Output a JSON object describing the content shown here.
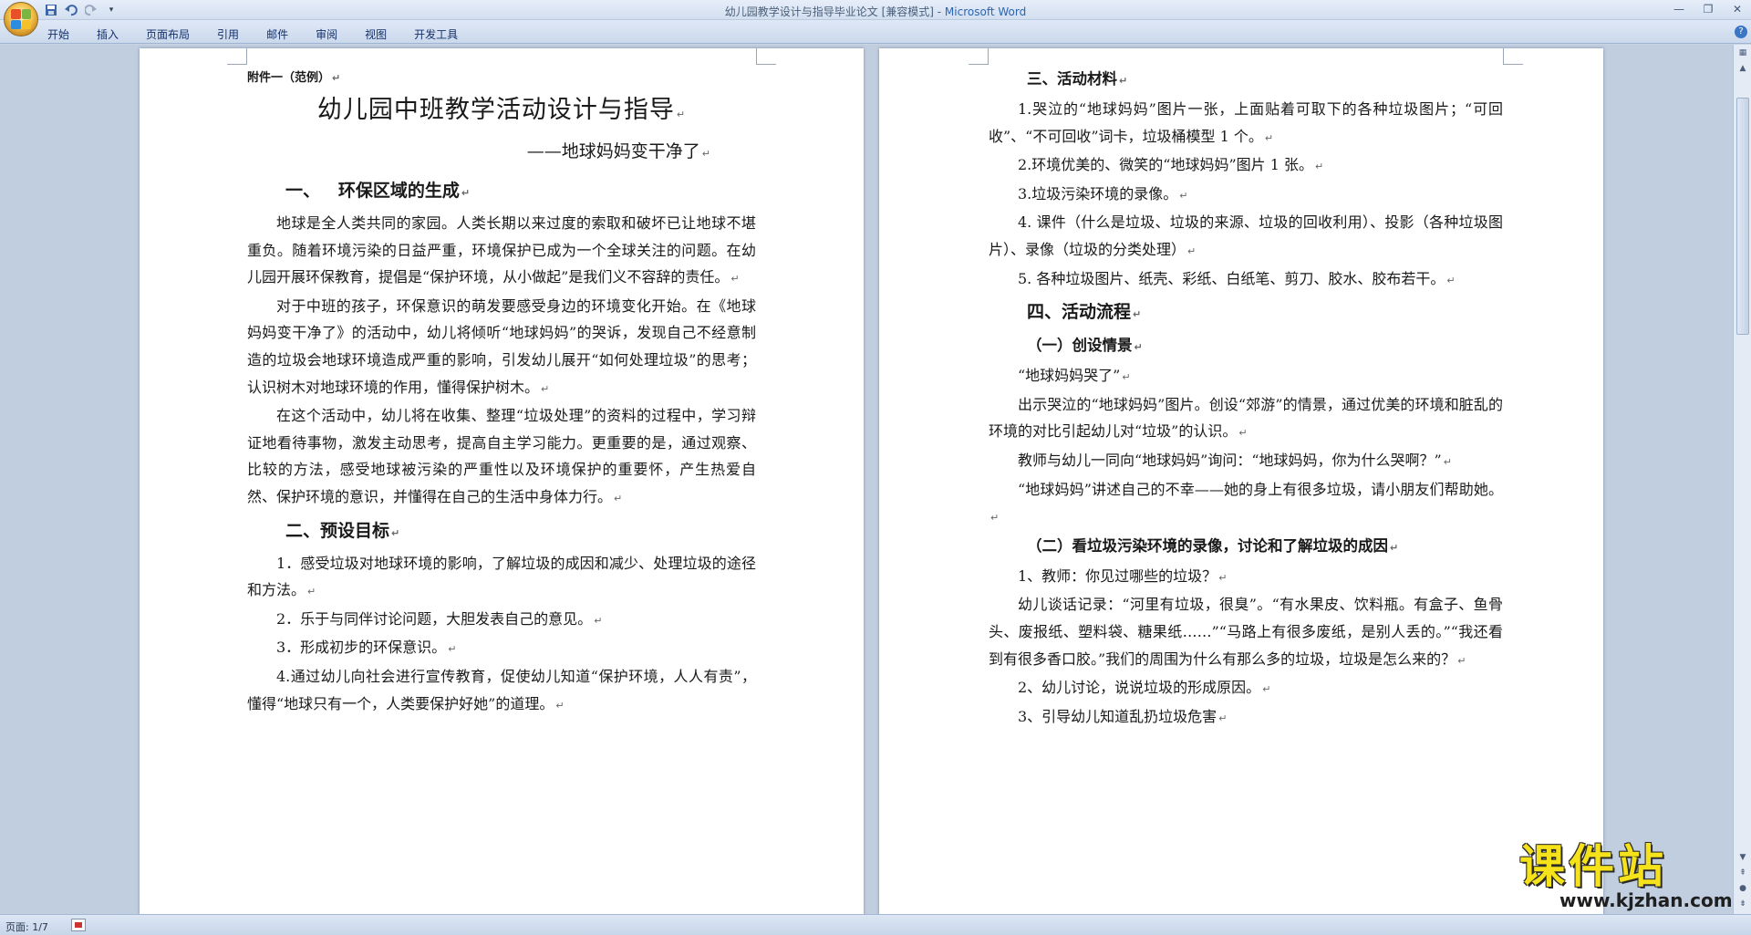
{
  "window": {
    "title": "幼儿园教学设计与指导毕业论文 [兼容模式] - ",
    "app_name": "Microsoft Word"
  },
  "quick_access": {
    "icons": [
      "save-icon",
      "undo-icon",
      "redo-icon",
      "customize-icon"
    ]
  },
  "ribbon": {
    "tabs": [
      "开始",
      "插入",
      "页面布局",
      "引用",
      "邮件",
      "审阅",
      "视图",
      "开发工具"
    ]
  },
  "status_bar": {
    "page_info": "页面: 1/7"
  },
  "watermark": {
    "main": "课件站",
    "url": "www.kjzhan.com"
  },
  "colors": {
    "title_accent": "#2a64b4",
    "watermark_yellow": "#f6e21a"
  },
  "page_left": {
    "annex": "附件一（范例）",
    "title": "幼儿园中班教学活动设计与指导",
    "subtitle": "——地球妈妈变干净了",
    "section1_heading": "一、   环保区域的生成",
    "paragraphs": [
      "地球是全人类共同的家园。人类长期以来过度的索取和破坏已让地球不堪重负。随着环境污染的日益严重，环境保护已成为一个全球关注的问题。在幼儿园开展环保教育，提倡是“保护环境，从小做起”是我们义不容辞的责任。",
      "对于中班的孩子，环保意识的萌发要感受身边的环境变化开始。在《地球妈妈变干净了》的活动中，幼儿将倾听“地球妈妈”的哭诉，发现自己不经意制造的垃圾会地球环境造成严重的影响，引发幼儿展开“如何处理垃圾”的思考；认识树木对地球环境的作用，懂得保护树木。",
      "在这个活动中，幼儿将在收集、整理“垃圾处理”的资料的过程中，学习辩证地看待事物，激发主动思考，提高自主学习能力。更重要的是，通过观察、比较的方法，感受地球被污染的严重性以及环境保护的重要怀，产生热爱自然、保护环境的意识，并懂得在自己的生活中身体力行。"
    ],
    "section2_heading": "二、预设目标",
    "goals": [
      "1．感受垃圾对地球环境的影响，了解垃圾的成因和减少、处理垃圾的途径和方法。",
      "2．乐于与同伴讨论问题，大胆发表自己的意见。",
      "3．形成初步的环保意识。",
      "4.通过幼儿向社会进行宣传教育，促使幼儿知道“保护环境，人人有责”，懂得“地球只有一个，人类要保护好她”的道理。"
    ]
  },
  "page_right": {
    "section3_heading": "三、活动材料",
    "materials": [
      "1.哭泣的“地球妈妈”图片一张，上面贴着可取下的各种垃圾图片；“可回收”、“不可回收”词卡，垃圾桶模型 1 个。",
      "2.环境优美的、微笑的“地球妈妈”图片 1 张。",
      "3.垃圾污染环境的录像。",
      "4. 课件（什么是垃圾、垃圾的来源、垃圾的回收利用）、投影（各种垃圾图片）、录像（垃圾的分类处理）",
      "5. 各种垃圾图片、纸壳、彩纸、白纸笔、剪刀、胶水、胶布若干。"
    ],
    "section4_heading": "四、活动流程",
    "sub1_heading": "（一）创设情景",
    "sub1_paragraphs": [
      "“地球妈妈哭了”",
      "出示哭泣的“地球妈妈”图片。创设“郊游”的情景，通过优美的环境和脏乱的环境的对比引起幼儿对“垃圾”的认识。",
      "教师与幼儿一同向“地球妈妈”询问：“地球妈妈，你为什么哭啊？”",
      "“地球妈妈”讲述自己的不幸——她的身上有很多垃圾，请小朋友们帮助她。"
    ],
    "sub2_heading": "（二）看垃圾污染环境的录像，讨论和了解垃圾的成因",
    "sub2_paragraphs": [
      "1、教师：你见过哪些的垃圾？",
      "幼儿谈话记录：“河里有垃圾，很臭”。“有水果皮、饮料瓶。有盒子、鱼骨头、废报纸、塑料袋、糖果纸……”“马路上有很多废纸，是别人丢的。”“我还看到有很多香口胶。”我们的周围为什么有那么多的垃圾，垃圾是怎么来的？",
      "2、幼儿讨论，说说垃圾的形成原因。",
      "3、引导幼儿知道乱扔垃圾危害"
    ]
  }
}
